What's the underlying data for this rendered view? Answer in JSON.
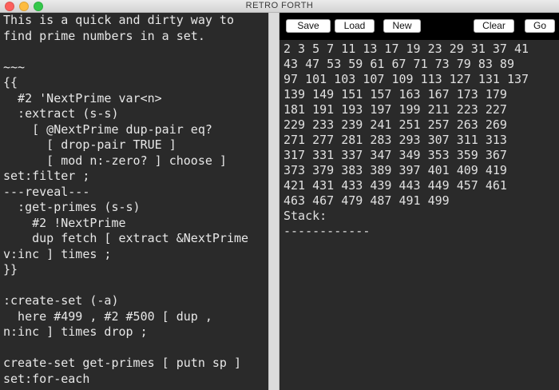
{
  "window": {
    "title": "RETRO FORTH"
  },
  "editor": {
    "lines": [
      "This is a quick and dirty way to",
      "find prime numbers in a set.",
      "",
      "~~~",
      "{{",
      "  #2 'NextPrime var<n>",
      "  :extract (s-s)",
      "    [ @NextPrime dup-pair eq?",
      "      [ drop-pair TRUE ]",
      "      [ mod n:-zero? ] choose ]",
      "set:filter ;",
      "---reveal---",
      "  :get-primes (s-s)",
      "    #2 !NextPrime",
      "    dup fetch [ extract &NextPrime",
      "v:inc ] times ;",
      "}}",
      "",
      ":create-set (-a)",
      "  here #499 , #2 #500 [ dup ,",
      "n:inc ] times drop ;",
      "",
      "create-set get-primes [ putn sp ]",
      "set:for-each",
      "~~~"
    ]
  },
  "toolbar": {
    "save": "Save",
    "load": "Load",
    "new": "New",
    "clear": "Clear",
    "go": "Go"
  },
  "output": {
    "lines": [
      "2 3 5 7 11 13 17 19 23 29 31 37 41",
      "43 47 53 59 61 67 71 73 79 83 89",
      "97 101 103 107 109 113 127 131 137",
      "139 149 151 157 163 167 173 179",
      "181 191 193 197 199 211 223 227",
      "229 233 239 241 251 257 263 269",
      "271 277 281 283 293 307 311 313",
      "317 331 337 347 349 353 359 367",
      "373 379 383 389 397 401 409 419",
      "421 431 433 439 443 449 457 461",
      "463 467 479 487 491 499",
      "Stack:",
      "------------"
    ]
  }
}
